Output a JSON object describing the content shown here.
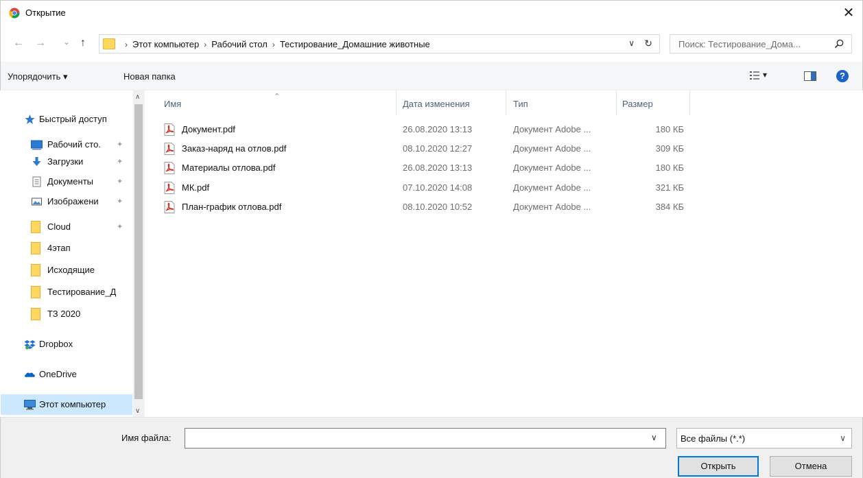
{
  "window": {
    "title": "Открытие",
    "close_glyph": "✕"
  },
  "nav": {
    "back_glyph": "←",
    "forward_glyph": "→",
    "recent_glyph": "⌄",
    "up_glyph": "↑",
    "breadcrumb": [
      "Этот компьютер",
      "Рабочий стол",
      "Тестирование_Домашние животные"
    ],
    "separator": "›",
    "dropdown_glyph": "∨",
    "refresh_glyph": "↻",
    "search_placeholder": "Поиск: Тестирование_Дома..."
  },
  "toolbar": {
    "organize_label": "Упорядочить ▾",
    "new_folder_label": "Новая папка",
    "view_dropdown_glyph": "▾",
    "help_glyph": "?"
  },
  "sidebar": {
    "items": [
      {
        "label": "Быстрый доступ",
        "icon": "star-icon",
        "pinned": false
      },
      {
        "label": "Рабочий сто.",
        "icon": "desktop-icon",
        "pinned": true
      },
      {
        "label": "Загрузки",
        "icon": "download-icon",
        "pinned": true
      },
      {
        "label": "Документы",
        "icon": "documents-icon",
        "pinned": true
      },
      {
        "label": "Изображени",
        "icon": "pictures-icon",
        "pinned": true
      },
      {
        "label": "Cloud",
        "icon": "folder-icon",
        "pinned": true
      },
      {
        "label": "4этап",
        "icon": "folder-icon",
        "pinned": false
      },
      {
        "label": "Исходящие",
        "icon": "folder-icon",
        "pinned": false
      },
      {
        "label": "Тестирование_Д",
        "icon": "folder-icon",
        "pinned": false
      },
      {
        "label": "ТЗ 2020",
        "icon": "folder-icon",
        "pinned": false
      },
      {
        "label": "Dropbox",
        "icon": "dropbox-icon",
        "pinned": false
      },
      {
        "label": "OneDrive",
        "icon": "onedrive-icon",
        "pinned": false
      },
      {
        "label": "Этот компьютер",
        "icon": "computer-icon",
        "pinned": false,
        "selected": true
      }
    ],
    "pin_glyph": "📌",
    "scroll_up_glyph": "∧",
    "scroll_down_glyph": "∨"
  },
  "columns": {
    "name": "Имя",
    "date": "Дата изменения",
    "type": "Тип",
    "size": "Размер",
    "sort_glyph": "⌃"
  },
  "files": [
    {
      "name": "Документ.pdf",
      "date": "26.08.2020 13:13",
      "type": "Документ Adobe ...",
      "size": "180 КБ"
    },
    {
      "name": "Заказ-наряд на отлов.pdf",
      "date": "08.10.2020 12:27",
      "type": "Документ Adobe ...",
      "size": "309 КБ"
    },
    {
      "name": "Материалы отлова.pdf",
      "date": "26.08.2020 13:13",
      "type": "Документ Adobe ...",
      "size": "180 КБ"
    },
    {
      "name": "МК.pdf",
      "date": "07.10.2020 14:08",
      "type": "Документ Adobe ...",
      "size": "321 КБ"
    },
    {
      "name": "План-график отлова.pdf",
      "date": "08.10.2020 10:52",
      "type": "Документ Adobe ...",
      "size": "384 КБ"
    }
  ],
  "footer": {
    "filename_label": "Имя файла:",
    "filename_value": "",
    "filename_dropdown_glyph": "∨",
    "filter_value": "Все файлы (*.*)",
    "filter_arrow": "∨",
    "open_label": "Открыть",
    "cancel_label": "Отмена"
  },
  "colors": {
    "accent": "#0078d7",
    "selection": "#cce8ff",
    "folder": "#ffd75e",
    "pdf_red": "#d9261c"
  }
}
